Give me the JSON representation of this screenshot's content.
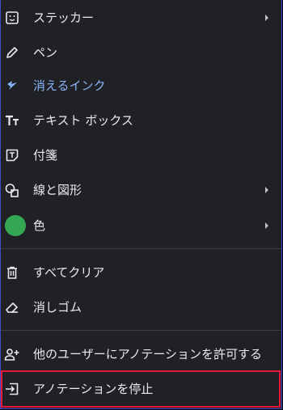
{
  "menu": {
    "items": [
      {
        "label": "ステッカー",
        "icon": "sticker-icon",
        "submenu": true
      },
      {
        "label": "ペン",
        "icon": "pen-icon"
      },
      {
        "label": "消えるインク",
        "icon": "disappearing-ink-icon",
        "accent": "#8ab4f8"
      },
      {
        "label": "テキスト ボックス",
        "icon": "text-box-icon"
      },
      {
        "label": "付箋",
        "icon": "sticky-note-icon"
      },
      {
        "label": "線と図形",
        "icon": "shapes-icon",
        "submenu": true
      },
      {
        "label": "色",
        "icon": "color-swatch-icon",
        "submenu": true,
        "swatch": "#34a853"
      },
      {
        "label": "すべてクリア",
        "icon": "trash-icon"
      },
      {
        "label": "消しゴム",
        "icon": "eraser-icon"
      },
      {
        "label": "他のユーザーにアノテーションを許可する",
        "icon": "add-person-icon"
      },
      {
        "label": "アノテーションを停止",
        "icon": "exit-icon",
        "highlight": "#e8173c"
      }
    ]
  },
  "colors": {
    "background": "#202124",
    "text": "#e8eaed",
    "accent": "#8ab4f8",
    "divider": "#3c4043"
  }
}
